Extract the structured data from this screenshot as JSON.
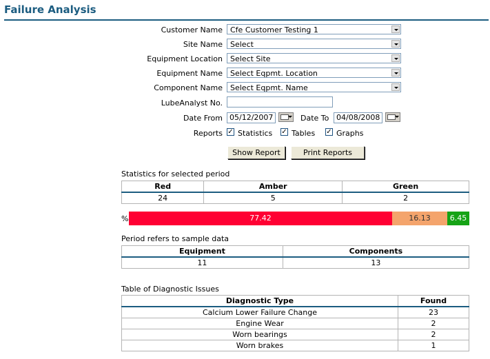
{
  "page": {
    "title": "Failure Analysis"
  },
  "form": {
    "customer_label": "Customer Name",
    "customer_value": "Cfe Customer Testing 1",
    "site_label": "Site Name",
    "site_value": "Select",
    "location_label": "Equipment Location",
    "location_value": "Select Site",
    "equipment_label": "Equipment Name",
    "equipment_value": "Select Eqpmt. Location",
    "component_label": "Component Name",
    "component_value": "Select Eqpmt. Name",
    "lube_label": "LubeAnalyst No.",
    "lube_value": "",
    "date_from_label": "Date From",
    "date_from_value": "05/12/2007",
    "date_to_label": "Date To",
    "date_to_value": "04/08/2008",
    "reports_label": "Reports",
    "report_options": [
      {
        "label": "Statistics",
        "checked": true
      },
      {
        "label": "Tables",
        "checked": true
      },
      {
        "label": "Graphs",
        "checked": true
      }
    ],
    "check_mark": "✓",
    "show_report": "Show Report",
    "print_reports": "Print Reports"
  },
  "stats": {
    "heading": "Statistics for selected period",
    "headers": [
      "Red",
      "Amber",
      "Green"
    ],
    "values": [
      "24",
      "5",
      "2"
    ],
    "percent_label": "%",
    "bars": [
      {
        "label": "77.42",
        "value": 77.42,
        "color": "#ff0033"
      },
      {
        "label": "16.13",
        "value": 16.13,
        "color": "#f4a46c"
      },
      {
        "label": "6.45",
        "value": 6.45,
        "color": "#16a316"
      }
    ]
  },
  "period": {
    "heading": "Period refers to sample data",
    "headers": [
      "Equipment",
      "Components"
    ],
    "values": [
      "11",
      "13"
    ]
  },
  "diagnostic": {
    "heading": "Table of Diagnostic Issues",
    "headers": [
      "Diagnostic Type",
      "Found"
    ],
    "rows": [
      [
        "Calcium Lower Failure Change",
        "23"
      ],
      [
        "Engine Wear",
        "2"
      ],
      [
        "Worn bearings",
        "2"
      ],
      [
        "Worn brakes",
        "1"
      ]
    ]
  }
}
